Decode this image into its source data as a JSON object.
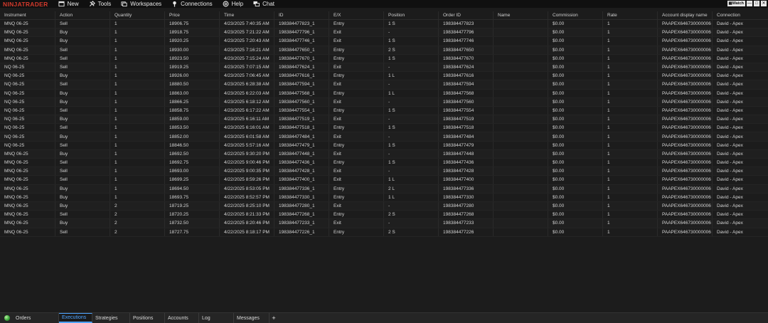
{
  "app": {
    "logo": "NINJATRADER"
  },
  "menu": [
    {
      "label": "New",
      "icon": "new-window-icon"
    },
    {
      "label": "Tools",
      "icon": "tools-icon"
    },
    {
      "label": "Workspaces",
      "icon": "workspaces-icon"
    },
    {
      "label": "Connections",
      "icon": "connections-icon"
    },
    {
      "label": "Help",
      "icon": "help-icon"
    },
    {
      "label": "Chat",
      "icon": "chat-icon"
    }
  ],
  "window": {
    "watch_label": "Watch"
  },
  "grid": {
    "columns": [
      "Instrument",
      "Action",
      "Quantity",
      "Price",
      "Time",
      "ID",
      "E/X",
      "Position",
      "Order ID",
      "Name",
      "Commission",
      "Rate",
      "Account display name",
      "Connection"
    ],
    "rows": [
      [
        "MNQ 06-25",
        "Sell",
        "1",
        "18906.75",
        "4/23/2025 7:40:35 AM",
        "198384477823_1",
        "Entry",
        "1 S",
        "198384477823",
        "",
        "$0.00",
        "1",
        "PAAPEX646730000006",
        "David - Apex"
      ],
      [
        "MNQ 06-25",
        "Buy",
        "1",
        "18918.75",
        "4/23/2025 7:21:22 AM",
        "198384477796_1",
        "Exit",
        "-",
        "198384477796",
        "",
        "$0.00",
        "1",
        "PAAPEX646730000006",
        "David - Apex"
      ],
      [
        "MNQ 06-25",
        "Buy",
        "1",
        "18920.25",
        "4/23/2025 7:20:43 AM",
        "198384477746_1",
        "Exit",
        "1 S",
        "198384477746",
        "",
        "$0.00",
        "1",
        "PAAPEX646730000006",
        "David - Apex"
      ],
      [
        "MNQ 06-25",
        "Sell",
        "1",
        "18930.00",
        "4/23/2025 7:16:21 AM",
        "198384477650_1",
        "Entry",
        "2 S",
        "198384477650",
        "",
        "$0.00",
        "1",
        "PAAPEX646730000006",
        "David - Apex"
      ],
      [
        "MNQ 06-25",
        "Sell",
        "1",
        "18923.50",
        "4/23/2025 7:15:24 AM",
        "198384477670_1",
        "Entry",
        "1 S",
        "198384477670",
        "",
        "$0.00",
        "1",
        "PAAPEX646730000006",
        "David - Apex"
      ],
      [
        "NQ 06-25",
        "Sell",
        "1",
        "18919.25",
        "4/23/2025 7:07:15 AM",
        "198384477624_1",
        "Exit",
        "-",
        "198384477624",
        "",
        "$0.00",
        "1",
        "PAAPEX646730000006",
        "David - Apex"
      ],
      [
        "NQ 06-25",
        "Buy",
        "1",
        "18926.00",
        "4/23/2025 7:06:45 AM",
        "198384477616_1",
        "Entry",
        "1 L",
        "198384477616",
        "",
        "$0.00",
        "1",
        "PAAPEX646730000006",
        "David - Apex"
      ],
      [
        "NQ 06-25",
        "Sell",
        "1",
        "18880.50",
        "4/23/2025 6:28:38 AM",
        "198384477594_1",
        "Exit",
        "-",
        "198384477594",
        "",
        "$0.00",
        "1",
        "PAAPEX646730000006",
        "David - Apex"
      ],
      [
        "NQ 06-25",
        "Buy",
        "1",
        "18863.00",
        "4/23/2025 6:22:03 AM",
        "198384477568_1",
        "Entry",
        "1 L",
        "198384477568",
        "",
        "$0.00",
        "1",
        "PAAPEX646730000006",
        "David - Apex"
      ],
      [
        "NQ 06-25",
        "Buy",
        "1",
        "18866.25",
        "4/23/2025 6:18:12 AM",
        "198384477560_1",
        "Exit",
        "-",
        "198384477560",
        "",
        "$0.00",
        "1",
        "PAAPEX646730000006",
        "David - Apex"
      ],
      [
        "NQ 06-25",
        "Sell",
        "1",
        "18858.75",
        "4/23/2025 6:17:22 AM",
        "198384477554_1",
        "Entry",
        "1 S",
        "198384477554",
        "",
        "$0.00",
        "1",
        "PAAPEX646730000006",
        "David - Apex"
      ],
      [
        "NQ 06-25",
        "Buy",
        "1",
        "18859.00",
        "4/23/2025 6:16:11 AM",
        "198384477519_1",
        "Exit",
        "-",
        "198384477519",
        "",
        "$0.00",
        "1",
        "PAAPEX646730000006",
        "David - Apex"
      ],
      [
        "NQ 06-25",
        "Sell",
        "1",
        "18853.50",
        "4/23/2025 6:16:01 AM",
        "198384477518_1",
        "Entry",
        "1 S",
        "198384477518",
        "",
        "$0.00",
        "1",
        "PAAPEX646730000006",
        "David - Apex"
      ],
      [
        "NQ 06-25",
        "Buy",
        "1",
        "18852.00",
        "4/23/2025 6:01:58 AM",
        "198384477484_1",
        "Exit",
        "-",
        "198384477484",
        "",
        "$0.00",
        "1",
        "PAAPEX646730000006",
        "David - Apex"
      ],
      [
        "NQ 06-25",
        "Sell",
        "1",
        "18846.50",
        "4/23/2025 5:57:16 AM",
        "198384477479_1",
        "Entry",
        "1 S",
        "198384477479",
        "",
        "$0.00",
        "1",
        "PAAPEX646730000006",
        "David - Apex"
      ],
      [
        "MNQ 06-25",
        "Buy",
        "1",
        "18692.50",
        "4/22/2025 9:30:20 PM",
        "198384477448_1",
        "Exit",
        "-",
        "198384477448",
        "",
        "$0.00",
        "1",
        "PAAPEX646730000006",
        "David - Apex"
      ],
      [
        "MNQ 06-25",
        "Sell",
        "1",
        "18692.75",
        "4/22/2025 9:00:46 PM",
        "198384477436_1",
        "Entry",
        "1 S",
        "198384477436",
        "",
        "$0.00",
        "1",
        "PAAPEX646730000006",
        "David - Apex"
      ],
      [
        "MNQ 06-25",
        "Sell",
        "1",
        "18693.00",
        "4/22/2025 9:00:35 PM",
        "198384477428_1",
        "Exit",
        "-",
        "198384477428",
        "",
        "$0.00",
        "1",
        "PAAPEX646730000006",
        "David - Apex"
      ],
      [
        "MNQ 06-25",
        "Sell",
        "1",
        "18699.25",
        "4/22/2025 8:59:26 PM",
        "198384477400_1",
        "Exit",
        "1 L",
        "198384477400",
        "",
        "$0.00",
        "1",
        "PAAPEX646730000006",
        "David - Apex"
      ],
      [
        "MNQ 06-25",
        "Buy",
        "1",
        "18694.50",
        "4/22/2025 8:53:05 PM",
        "198384477336_1",
        "Entry",
        "2 L",
        "198384477336",
        "",
        "$0.00",
        "1",
        "PAAPEX646730000006",
        "David - Apex"
      ],
      [
        "MNQ 06-25",
        "Buy",
        "1",
        "18693.75",
        "4/22/2025 8:52:57 PM",
        "198384477330_1",
        "Entry",
        "1 L",
        "198384477330",
        "",
        "$0.00",
        "1",
        "PAAPEX646730000006",
        "David - Apex"
      ],
      [
        "MNQ 06-25",
        "Buy",
        "2",
        "18719.25",
        "4/22/2025 8:25:10 PM",
        "198384477280_1",
        "Exit",
        "-",
        "198384477280",
        "",
        "$0.00",
        "1",
        "PAAPEX646730000006",
        "David - Apex"
      ],
      [
        "MNQ 06-25",
        "Sell",
        "2",
        "18720.25",
        "4/22/2025 8:21:33 PM",
        "198384477268_1",
        "Entry",
        "2 S",
        "198384477268",
        "",
        "$0.00",
        "1",
        "PAAPEX646730000006",
        "David - Apex"
      ],
      [
        "MNQ 06-25",
        "Buy",
        "2",
        "18732.50",
        "4/22/2025 8:20:46 PM",
        "198384477233_1",
        "Exit",
        "-",
        "198384477233",
        "",
        "$0.00",
        "1",
        "PAAPEX646730000006",
        "David - Apex"
      ],
      [
        "MNQ 06-25",
        "Sell",
        "2",
        "18727.75",
        "4/22/2025 8:18:17 PM",
        "198384477226_1",
        "Entry",
        "2 S",
        "198384477226",
        "",
        "$0.00",
        "1",
        "PAAPEX646730000006",
        "David - Apex"
      ]
    ]
  },
  "tabs": [
    {
      "label": "Orders",
      "active": false
    },
    {
      "label": "Executions",
      "active": true
    },
    {
      "label": "Strategies",
      "active": false
    },
    {
      "label": "Positions",
      "active": false
    },
    {
      "label": "Accounts",
      "active": false
    },
    {
      "label": "Log",
      "active": false
    },
    {
      "label": "Messages",
      "active": false
    }
  ],
  "add_tab_label": "+",
  "colors": {
    "logo": "#d33a2c",
    "active_tab": "#4da3ff",
    "connection_status": "#3aa83a"
  }
}
